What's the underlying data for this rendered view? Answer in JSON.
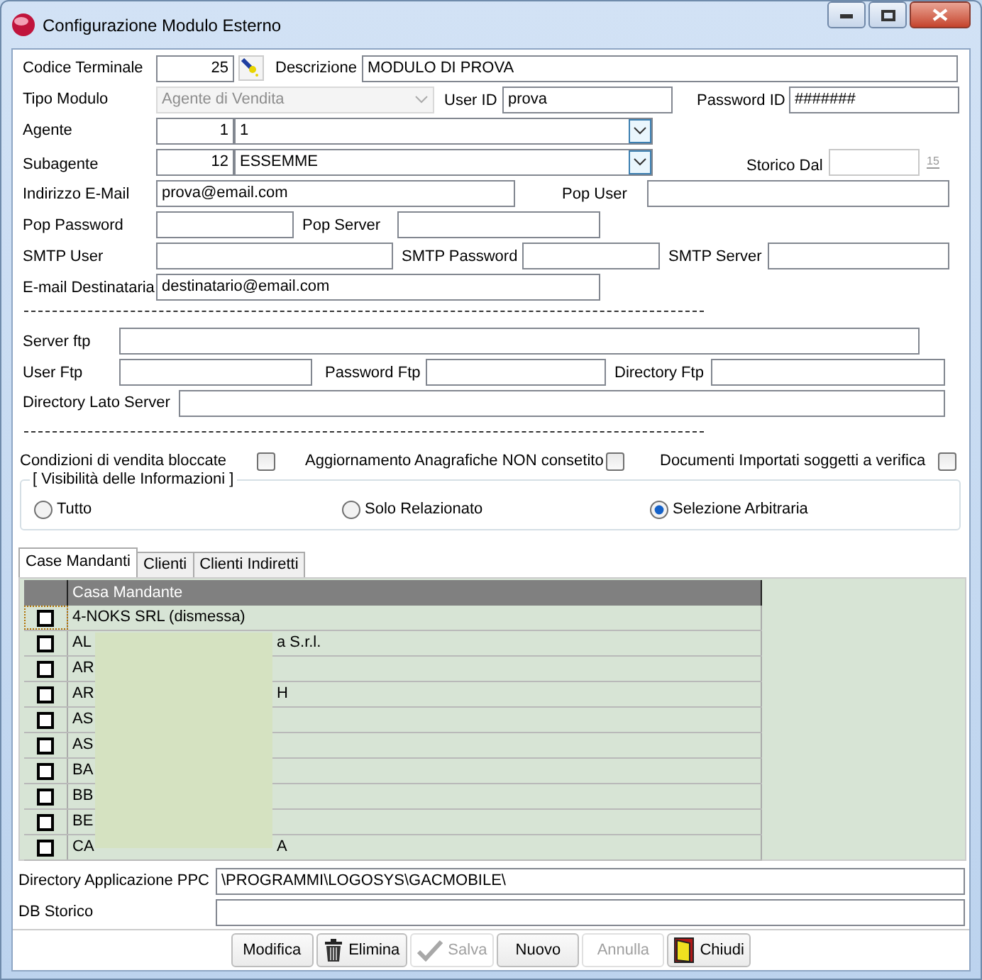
{
  "window": {
    "title": "Configurazione Modulo Esterno"
  },
  "codice_terminale": {
    "label": "Codice Terminale",
    "value": "25"
  },
  "descrizione": {
    "label": "Descrizione",
    "value": "MODULO DI PROVA"
  },
  "tipo_modulo": {
    "label": "Tipo Modulo",
    "value": "Agente di Vendita",
    "disabled": true
  },
  "user_id": {
    "label": "User ID",
    "value": "prova"
  },
  "password_id": {
    "label": "Password ID",
    "value": "#######"
  },
  "agente": {
    "label": "Agente",
    "code": "1",
    "value": "1"
  },
  "subagente": {
    "label": "Subagente",
    "code": "12",
    "value": "ESSEMME"
  },
  "storico_dal": {
    "label": "Storico Dal",
    "calendar_day": "15"
  },
  "indirizzo_email": {
    "label": "Indirizzo E-Mail",
    "value": "prova@email.com"
  },
  "pop_user": {
    "label": "Pop User"
  },
  "pop_password": {
    "label": "Pop Password"
  },
  "pop_server": {
    "label": "Pop Server"
  },
  "smtp_user": {
    "label": "SMTP User"
  },
  "smtp_password": {
    "label": "SMTP Password"
  },
  "smtp_server": {
    "label": "SMTP Server"
  },
  "email_destinataria": {
    "label": "E-mail Destinataria",
    "value": "destinatario@email.com"
  },
  "server_ftp": {
    "label": "Server ftp"
  },
  "user_ftp": {
    "label": "User Ftp"
  },
  "password_ftp": {
    "label": "Password Ftp"
  },
  "directory_ftp": {
    "label": "Directory Ftp"
  },
  "directory_lato_server": {
    "label": "Directory Lato Server"
  },
  "options": [
    {
      "label": "Condizioni di vendita bloccate",
      "checked": false
    },
    {
      "label": "Aggiornamento Anagrafiche NON consetito",
      "checked": false
    },
    {
      "label": "Documenti Importati soggetti a verifica",
      "checked": false
    }
  ],
  "visibility": {
    "title": "[ Visibilità delle Informazioni ]",
    "options": [
      {
        "label": "Tutto",
        "selected": false
      },
      {
        "label": "Solo Relazionato",
        "selected": false
      },
      {
        "label": "Selezione Arbitraria",
        "selected": true
      }
    ]
  },
  "tabs": [
    {
      "label": "Case Mandanti",
      "selected": true
    },
    {
      "label": "Clienti",
      "selected": false
    },
    {
      "label": "Clienti Indiretti",
      "selected": false
    }
  ],
  "grid": {
    "columns": [
      "Casa Mandante"
    ],
    "rows": [
      {
        "checked": false,
        "text": "4-NOKS SRL (dismessa)"
      },
      {
        "checked": false,
        "text": "AL",
        "suffix": "a S.r.l."
      },
      {
        "checked": false,
        "text": "AR"
      },
      {
        "checked": false,
        "text": "AR",
        "suffix": "H"
      },
      {
        "checked": false,
        "text": "AS"
      },
      {
        "checked": false,
        "text": "AS"
      },
      {
        "checked": false,
        "text": "BA"
      },
      {
        "checked": false,
        "text": "BB"
      },
      {
        "checked": false,
        "text": "BE"
      },
      {
        "checked": false,
        "text": "CA",
        "suffix": "A"
      }
    ]
  },
  "directory_applicazione_ppc": {
    "label": "Directory Applicazione PPC",
    "value": "\\PROGRAMMI\\LOGOSYS\\GACMOBILE\\"
  },
  "db_storico": {
    "label": "DB Storico"
  },
  "buttons": [
    {
      "label": "Modifica",
      "kind": "plain",
      "disabled": false
    },
    {
      "label": "Elimina",
      "kind": "trash",
      "disabled": false
    },
    {
      "label": "Salva",
      "kind": "check",
      "disabled": true
    },
    {
      "label": "Nuovo",
      "kind": "plain",
      "disabled": false
    },
    {
      "label": "Annulla",
      "kind": "plain",
      "disabled": true
    },
    {
      "label": "Chiudi",
      "kind": "door",
      "disabled": false
    }
  ]
}
